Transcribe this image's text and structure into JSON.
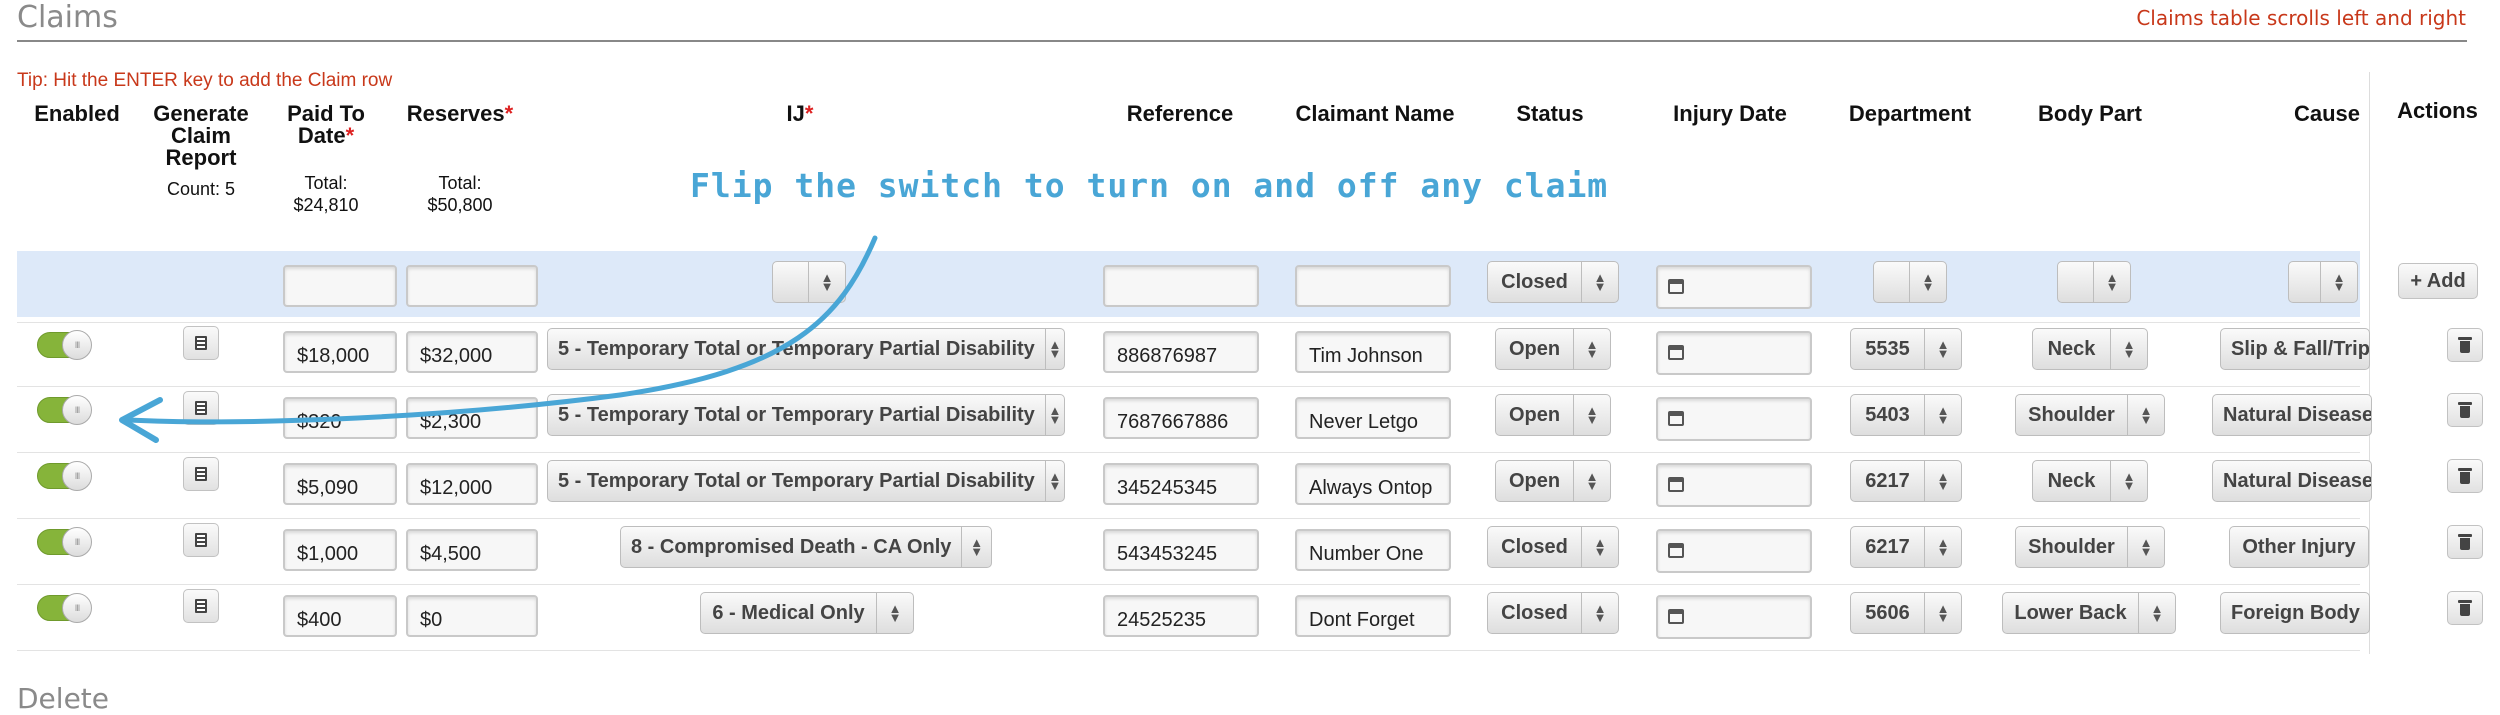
{
  "section_title": "Claims",
  "scroll_note": "Claims table scrolls left and right",
  "tip": "Tip: Hit the ENTER key to add the Claim row",
  "headers": {
    "enabled": "Enabled",
    "generate_line1": "Generate",
    "generate_line2": "Claim",
    "generate_line3": "Report",
    "paid_line1": "Paid To",
    "paid_line2": "Date",
    "reserves": "Reserves",
    "ij": "IJ",
    "reference": "Reference",
    "claimant": "Claimant Name",
    "status": "Status",
    "injury_date": "Injury Date",
    "department": "Department",
    "body_part": "Body Part",
    "cause": "Cause",
    "actions": "Actions",
    "required_mark": "*"
  },
  "summary": {
    "count": "Count: 5",
    "paid_total_label": "Total:",
    "paid_total_value": "$24,810",
    "reserves_total_label": "Total:",
    "reserves_total_value": "$50,800"
  },
  "filter_row": {
    "status": "Closed",
    "add_button": "+ Add"
  },
  "annotation": "Flip the switch to turn on and off any claim",
  "rows": [
    {
      "enabled": true,
      "paid": "$18,000",
      "reserves": "$32,000",
      "ij": "5 - Temporary Total or Temporary Partial Disability",
      "reference": "886876987",
      "claimant": "Tim Johnson",
      "status": "Open",
      "department": "5535",
      "body_part": "Neck",
      "cause": "Slip & Fall/Trip"
    },
    {
      "enabled": true,
      "paid": "$320",
      "reserves": "$2,300",
      "ij": "5 - Temporary Total or Temporary Partial Disability",
      "reference": "7687667886",
      "claimant": "Never Letgo",
      "status": "Open",
      "department": "5403",
      "body_part": "Shoulder",
      "cause": "Natural Disease"
    },
    {
      "enabled": true,
      "paid": "$5,090",
      "reserves": "$12,000",
      "ij": "5 - Temporary Total or Temporary Partial Disability",
      "reference": "345245345",
      "claimant": "Always Ontop",
      "status": "Open",
      "department": "6217",
      "body_part": "Neck",
      "cause": "Natural Disease"
    },
    {
      "enabled": true,
      "paid": "$1,000",
      "reserves": "$4,500",
      "ij": "8 - Compromised Death - CA Only",
      "reference": "543453245",
      "claimant": "Number One",
      "status": "Closed",
      "department": "6217",
      "body_part": "Shoulder",
      "cause": "Other Injury"
    },
    {
      "enabled": true,
      "paid": "$400",
      "reserves": "$0",
      "ij": "6 - Medical Only",
      "reference": "24525235",
      "claimant": "Dont Forget",
      "status": "Closed",
      "department": "5606",
      "body_part": "Lower Back",
      "cause": "Foreign Body"
    }
  ],
  "delete_title": "Delete",
  "colors": {
    "accent_red": "#c8381a",
    "toggle_green": "#86b43a",
    "annotation_blue": "#49a6d6",
    "filter_band": "#dde9f9"
  }
}
